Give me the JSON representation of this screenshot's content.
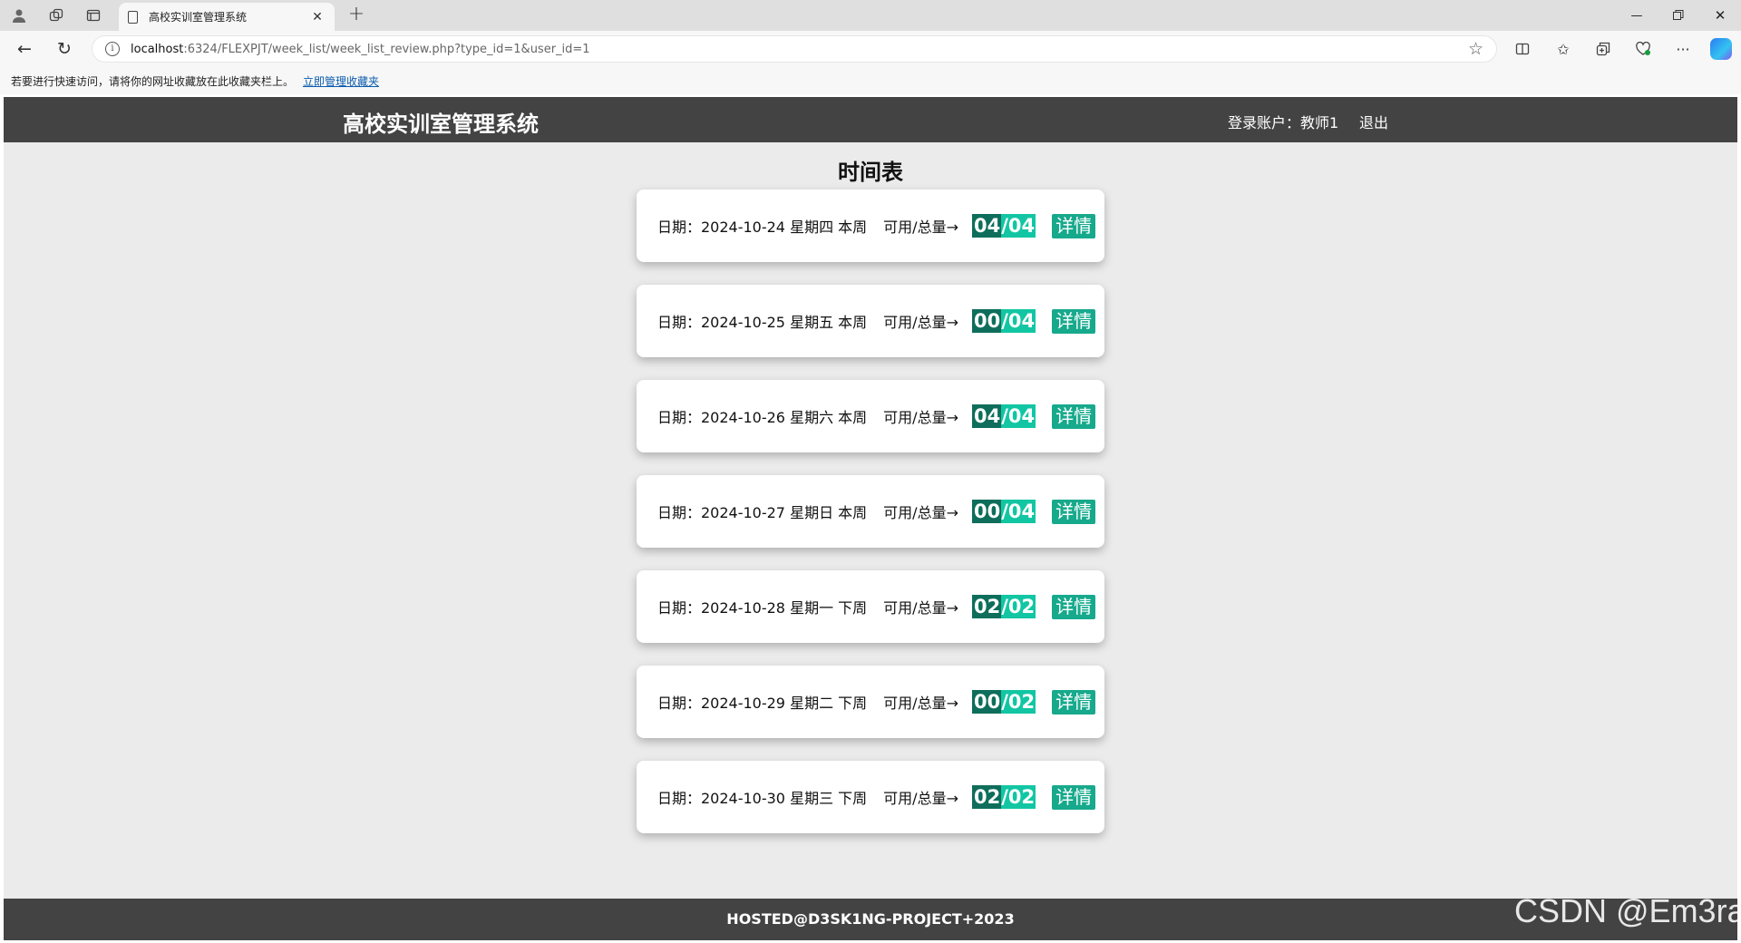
{
  "browser": {
    "tab_title": "高校实训室管理系统",
    "url_host": "localhost",
    "url_rest": ":6324/FLEXPJT/week_list/week_list_review.php?type_id=1&user_id=1",
    "favorites_hint": "若要进行快速访问，请将你的网址收藏放在此收藏夹栏上。",
    "favorites_link": "立即管理收藏夹"
  },
  "header": {
    "title": "高校实训室管理系统",
    "account": "登录账户：教师1",
    "logout": "退出"
  },
  "page_title": "时间表",
  "schedule": [
    {
      "date": "日期：2024-10-24 星期四 本周",
      "ratio_label": "可用/总量→",
      "available": "04",
      "total": "/04",
      "detail": "详情"
    },
    {
      "date": "日期：2024-10-25 星期五 本周",
      "ratio_label": "可用/总量→",
      "available": "00",
      "total": "/04",
      "detail": "详情"
    },
    {
      "date": "日期：2024-10-26 星期六 本周",
      "ratio_label": "可用/总量→",
      "available": "04",
      "total": "/04",
      "detail": "详情"
    },
    {
      "date": "日期：2024-10-27 星期日 本周",
      "ratio_label": "可用/总量→",
      "available": "00",
      "total": "/04",
      "detail": "详情"
    },
    {
      "date": "日期：2024-10-28 星期一 下周",
      "ratio_label": "可用/总量→",
      "available": "02",
      "total": "/02",
      "detail": "详情"
    },
    {
      "date": "日期：2024-10-29 星期二 下周",
      "ratio_label": "可用/总量→",
      "available": "00",
      "total": "/02",
      "detail": "详情"
    },
    {
      "date": "日期：2024-10-30 星期三 下周",
      "ratio_label": "可用/总量→",
      "available": "02",
      "total": "/02",
      "detail": "详情"
    }
  ],
  "footer": "HOSTED@D3SK1NG-PROJECT+2023",
  "watermark": "CSDN @Em3ra",
  "colors": {
    "header_bg": "#434343",
    "page_bg": "#ebebeb",
    "ratio_dark": "#0e6e5b",
    "ratio_light": "#12c6a3",
    "detail_button": "#17a98c"
  }
}
